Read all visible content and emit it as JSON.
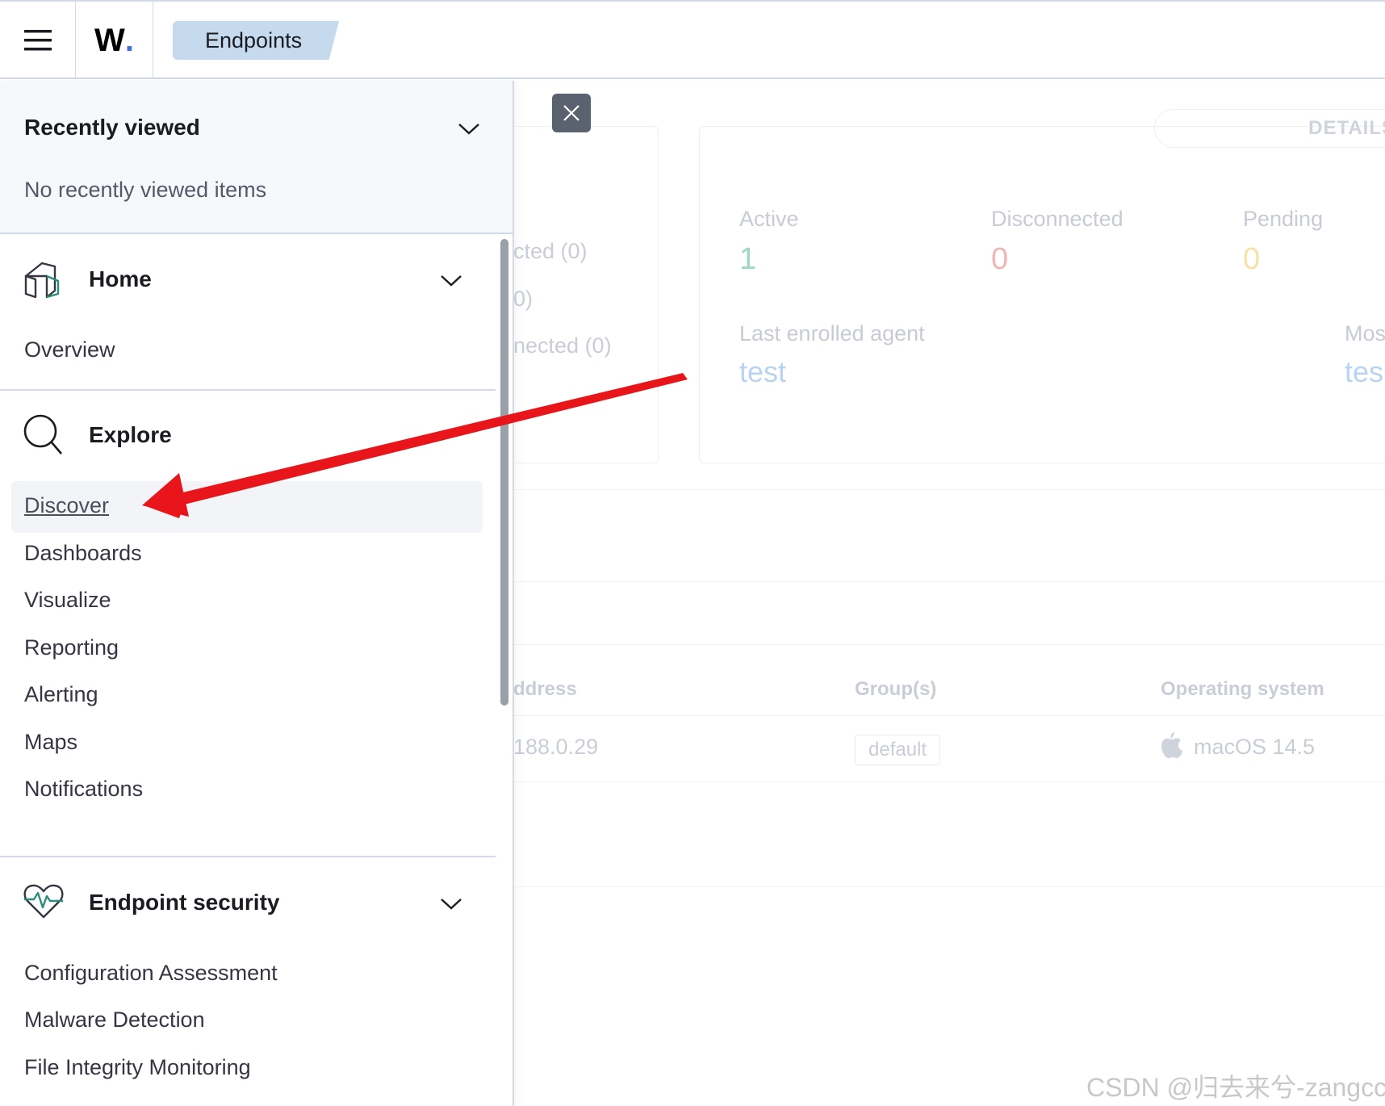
{
  "header": {
    "menu_icon": "hamburger-icon",
    "logo_letter": "W",
    "logo_dot": ".",
    "breadcrumb": "Endpoints"
  },
  "background": {
    "details_label": "DETAILS",
    "left_card": {
      "items": [
        "cted (0)",
        "0)",
        "nected (0)"
      ]
    },
    "stats": {
      "active_label": "Active",
      "active_value": "1",
      "disconnected_label": "Disconnected",
      "disconnected_value": "0",
      "pending_label": "Pending",
      "pending_value": "0",
      "last_enrolled_label": "Last enrolled agent",
      "last_enrolled_value": "test",
      "most_label": "Mos",
      "most_value": "tes"
    },
    "table": {
      "headers": [
        "ddress",
        "Group(s)",
        "Operating system"
      ],
      "row": {
        "address": "188.0.29",
        "group": "default",
        "os": "macOS 14.5",
        "os_icon": "apple-icon"
      }
    },
    "colors": {
      "active": "#9fd6c7",
      "disconnected": "#f2b5b5",
      "pending": "#f5e3a8",
      "link": "#b9d3f2"
    }
  },
  "nav": {
    "recent": {
      "title": "Recently viewed",
      "empty": "No recently viewed items"
    },
    "home": {
      "title": "Home",
      "icon": "home-icon",
      "items": [
        "Overview"
      ]
    },
    "explore": {
      "title": "Explore",
      "icon": "explore-icon",
      "items": [
        "Discover",
        "Dashboards",
        "Visualize",
        "Reporting",
        "Alerting",
        "Maps",
        "Notifications"
      ]
    },
    "endpoint_security": {
      "title": "Endpoint security",
      "icon": "heartbeat-icon",
      "items": [
        "Configuration Assessment",
        "Malware Detection",
        "File Integrity Monitoring"
      ]
    }
  },
  "watermark": "CSDN @归去来兮-zangcc"
}
